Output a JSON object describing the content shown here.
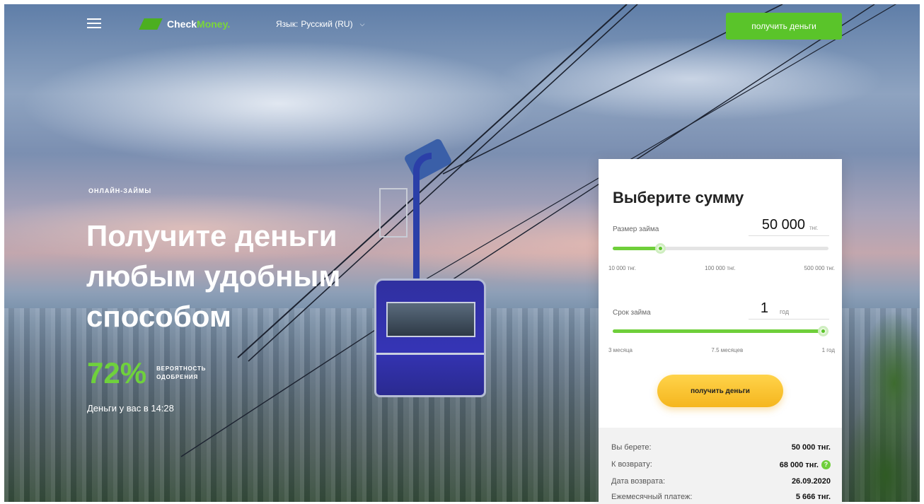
{
  "header": {
    "brand_part1": "Check",
    "brand_part2": "Money",
    "brand_dot": ".",
    "lang_label": "Язык:",
    "lang_value": "Русский (RU)",
    "cta_label": "получить деньги"
  },
  "hero": {
    "eyebrow": "онлайн-займы",
    "headline": "Получите деньги любым удобным способом",
    "stat_value": "72%",
    "stat_label": "вероятность одобрения",
    "subnote": "Деньги у вас в 14:28"
  },
  "calculator": {
    "title": "Выберите сумму",
    "amount": {
      "label": "Размер займа",
      "value": "50 000",
      "unit": "тнг.",
      "min_label": "10 000 тнг.",
      "mid_label": "100 000 тнг.",
      "max_label": "500 000 тнг.",
      "fill_fraction": 0.22
    },
    "term": {
      "label": "Срок займа",
      "value": "1",
      "unit": "год",
      "min_label": "3 месяца",
      "mid_label": "7.5 месяцев",
      "max_label": "1 год",
      "fill_fraction": 1.0
    },
    "cta_label": "получить деньги",
    "summary": [
      {
        "label": "Вы берете:",
        "value": "50 000 тнг."
      },
      {
        "label": "К возврату:",
        "value": "68 000 тнг."
      },
      {
        "label": "Дата возврата:",
        "value": "26.09.2020"
      },
      {
        "label": "Ежемесячный платеж:",
        "value": "5 666 тнг."
      }
    ]
  },
  "colors": {
    "accent_green": "#5ac42a",
    "cta_yellow": "#f5b61e"
  },
  "icons": {
    "menu": "hamburger-icon",
    "chevron": "chevron-down-icon",
    "info": "info-icon"
  }
}
